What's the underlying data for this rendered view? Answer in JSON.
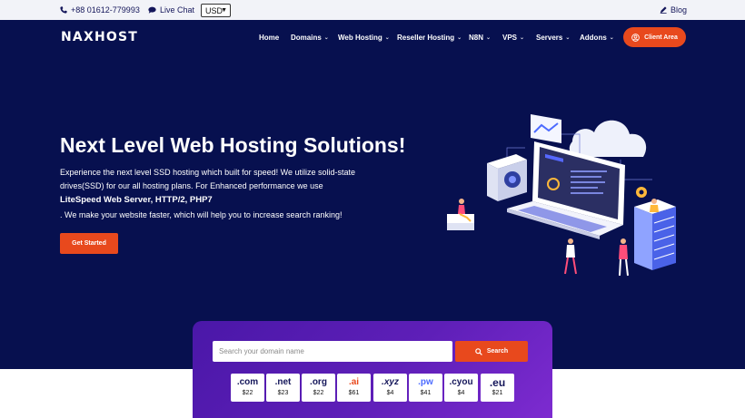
{
  "topbar": {
    "phone": "+88 01612-779993",
    "live_chat": "Live Chat",
    "currency": "USD",
    "blog": "Blog"
  },
  "header": {
    "logo": "NAXHOST",
    "nav": [
      {
        "label": "Home",
        "dropdown": false
      },
      {
        "label": "Domains",
        "dropdown": true
      },
      {
        "label": "Web Hosting",
        "dropdown": true
      },
      {
        "label": "Reseller Hosting",
        "dropdown": true
      },
      {
        "label": "N8N",
        "dropdown": true
      },
      {
        "label": "VPS",
        "dropdown": true
      },
      {
        "label": "Servers",
        "dropdown": true
      },
      {
        "label": "Addons",
        "dropdown": true
      }
    ],
    "client_area": "Client Area"
  },
  "hero": {
    "title": "Next Level Web Hosting Solutions!",
    "line1": "Experience the next level SSD hosting which built for speed! We utilize solid-state",
    "line2": "drives(SSD) for our all hosting plans. For Enhanced performance we use",
    "line3": "LiteSpeed Web Server, HTTP/2, PHP7",
    "line4": ". We make your website faster, which will help you to increase search ranking!",
    "cta": "Get Started"
  },
  "domain_search": {
    "placeholder": "Search your domain name",
    "button": "Search",
    "tlds": [
      {
        "name": ".com",
        "price": "$22"
      },
      {
        "name": ".net",
        "price": "$23"
      },
      {
        "name": ".org",
        "price": "$22"
      },
      {
        "name": ".ai",
        "price": "$61"
      },
      {
        "name": ".xyz",
        "price": "$4"
      },
      {
        "name": ".pw",
        "price": "$41"
      },
      {
        "name": ".cyou",
        "price": "$4"
      },
      {
        "name": ".eu",
        "price": "$21"
      }
    ]
  },
  "colors": {
    "hero_bg": "#07104f",
    "accent": "#e8491d",
    "topbar_bg": "#f2f3f8",
    "search_card": "#5a1db5"
  }
}
